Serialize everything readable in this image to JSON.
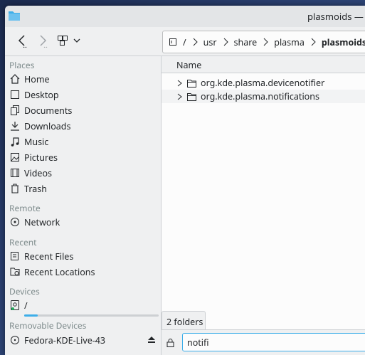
{
  "window": {
    "title": "plasmoids — Dolphin"
  },
  "breadcrumb": [
    {
      "label": "/"
    },
    {
      "label": "usr"
    },
    {
      "label": "share"
    },
    {
      "label": "plasma"
    },
    {
      "label": "plasmoids"
    }
  ],
  "sidebar": {
    "places_header": "Places",
    "places": [
      {
        "label": "Home",
        "icon": "home-icon"
      },
      {
        "label": "Desktop",
        "icon": "desktop-icon"
      },
      {
        "label": "Documents",
        "icon": "documents-icon"
      },
      {
        "label": "Downloads",
        "icon": "downloads-icon"
      },
      {
        "label": "Music",
        "icon": "music-icon"
      },
      {
        "label": "Pictures",
        "icon": "pictures-icon"
      },
      {
        "label": "Videos",
        "icon": "videos-icon"
      },
      {
        "label": "Trash",
        "icon": "trash-icon"
      }
    ],
    "remote_header": "Remote",
    "remote": [
      {
        "label": "Network",
        "icon": "network-icon"
      }
    ],
    "recent_header": "Recent",
    "recent": [
      {
        "label": "Recent Files",
        "icon": "recent-files-icon"
      },
      {
        "label": "Recent Locations",
        "icon": "recent-locations-icon"
      }
    ],
    "devices_header": "Devices",
    "devices": [
      {
        "label": "/",
        "icon": "drive-icon",
        "usage": 0.1
      }
    ],
    "removable_header": "Removable Devices",
    "removable": [
      {
        "label": "Fedora-KDE-Live-43",
        "icon": "optical-drive-icon"
      }
    ]
  },
  "files": {
    "column_name": "Name",
    "items": [
      {
        "name": "org.kde.plasma.devicenotifier"
      },
      {
        "name": "org.kde.plasma.notifications"
      }
    ]
  },
  "status": {
    "text": "2 folders"
  },
  "filter": {
    "value": "notifi"
  },
  "colors": {
    "accent": "#3daee9",
    "window_bg": "#eff0f1",
    "view_bg": "#fcfcfc"
  }
}
